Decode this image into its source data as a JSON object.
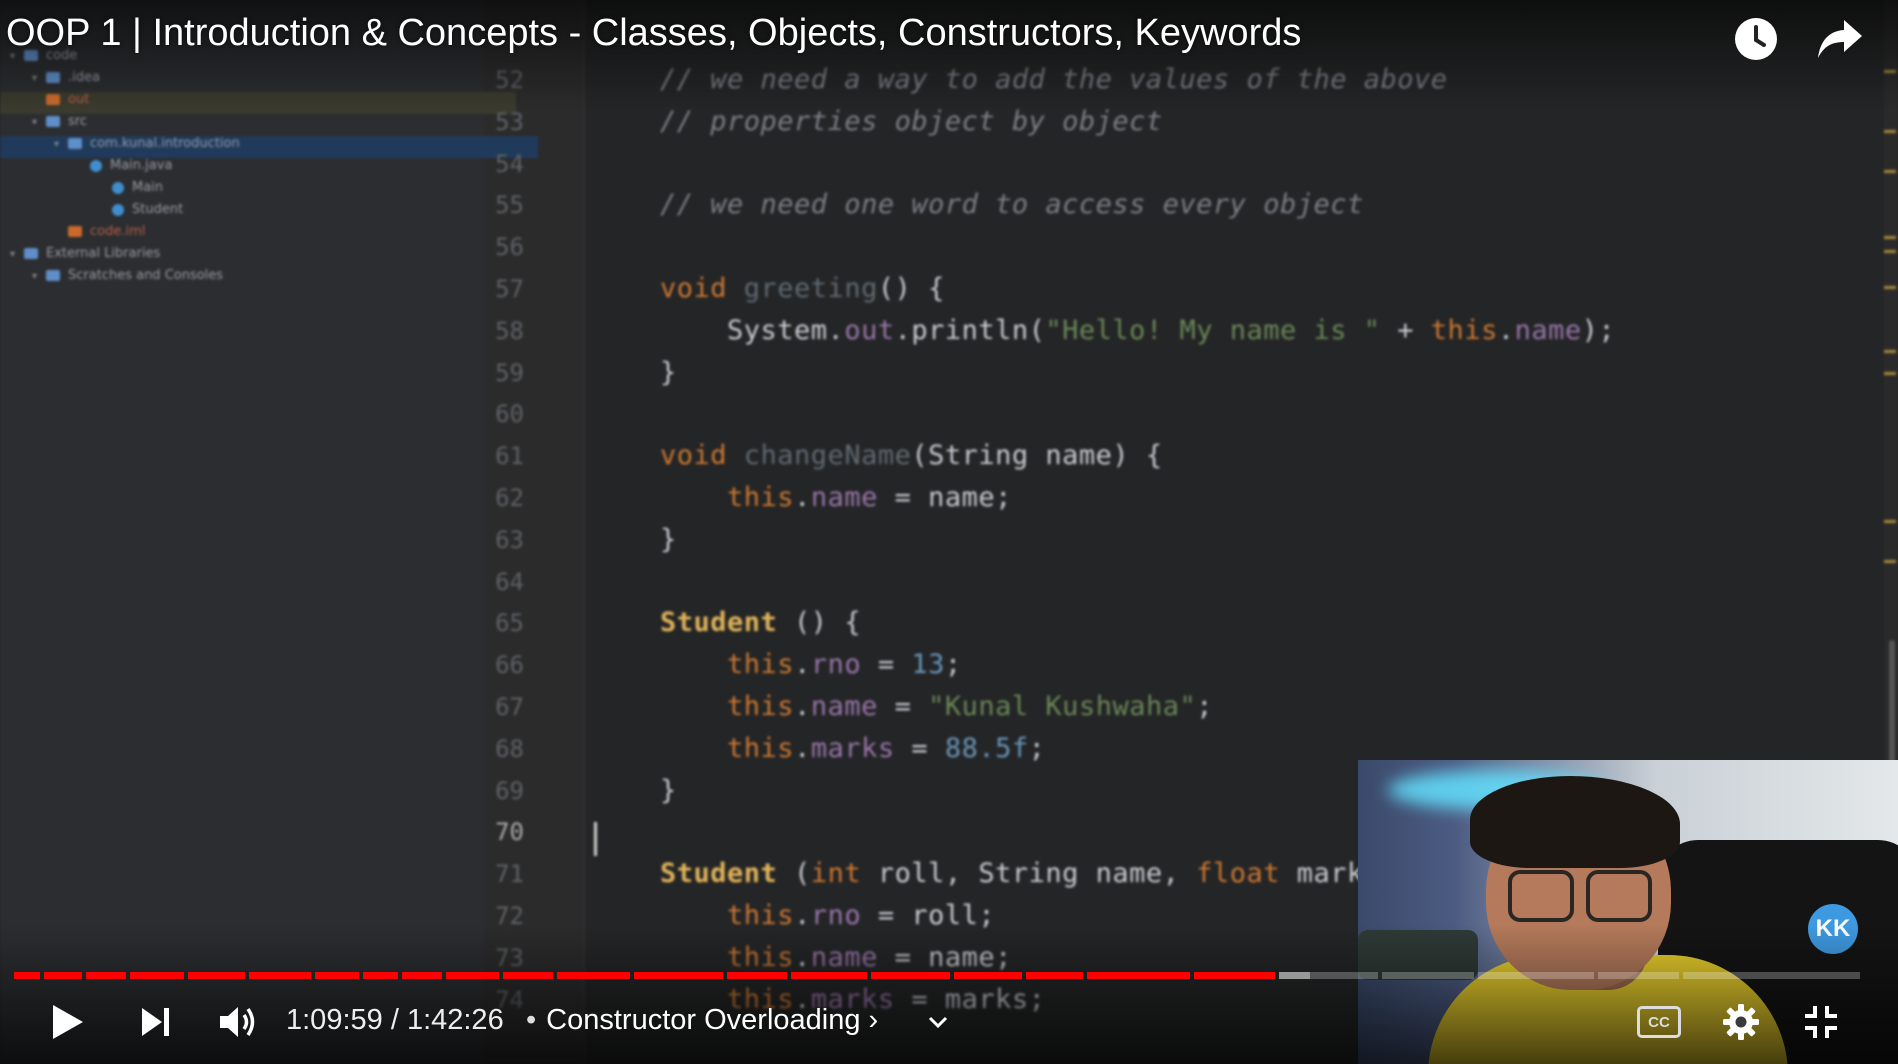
{
  "title": "OOP 1 | Introduction & Concepts - Classes, Objects, Constructors, Keywords",
  "top_controls": {
    "watch_later_icon": "clock-icon",
    "share_icon": "share-arrow-icon"
  },
  "ide": {
    "project_tree": [
      {
        "label": "code",
        "kind": "folder",
        "indent": 0
      },
      {
        "label": ".idea",
        "kind": "folder",
        "indent": 1
      },
      {
        "label": "out",
        "kind": "orange",
        "indent": 1
      },
      {
        "label": "src",
        "kind": "folder",
        "indent": 1
      },
      {
        "label": "com.kunal.introduction",
        "kind": "folder",
        "indent": 2
      },
      {
        "label": "Main.java",
        "kind": "java",
        "indent": 3
      },
      {
        "label": "Main",
        "kind": "java",
        "indent": 4
      },
      {
        "label": "Student",
        "kind": "java",
        "indent": 4
      },
      {
        "label": "code.iml",
        "kind": "orange",
        "indent": 2
      },
      {
        "label": "External Libraries",
        "kind": "ext",
        "indent": 0
      },
      {
        "label": "Scratches and Consoles",
        "kind": "ext",
        "indent": 1
      }
    ],
    "line_numbers": [
      "52",
      "53",
      "54",
      "55",
      "56",
      "57",
      "58",
      "59",
      "60",
      "61",
      "62",
      "63",
      "64",
      "65",
      "66",
      "67",
      "68",
      "69",
      "70",
      "71",
      "72",
      "73",
      "74"
    ],
    "current_line": "70",
    "code_lines": [
      {
        "ln": "52",
        "tokens": [
          {
            "c": "cm",
            "t": "// we need a way to add the values of the above"
          }
        ]
      },
      {
        "ln": "53",
        "tokens": [
          {
            "c": "cm",
            "t": "// properties object by object"
          }
        ]
      },
      {
        "ln": "54",
        "tokens": []
      },
      {
        "ln": "55",
        "tokens": [
          {
            "c": "cm",
            "t": "// we need one word to access every object"
          }
        ]
      },
      {
        "ln": "56",
        "tokens": []
      },
      {
        "ln": "57",
        "tokens": [
          {
            "c": "kw",
            "t": "void "
          },
          {
            "c": "fn",
            "t": "greeting"
          },
          {
            "c": "pl",
            "t": "() {"
          }
        ]
      },
      {
        "ln": "58",
        "tokens": [
          {
            "c": "pl",
            "t": "    System."
          },
          {
            "c": "fld",
            "t": "out"
          },
          {
            "c": "pl",
            "t": ".println("
          },
          {
            "c": "str",
            "t": "\"Hello! My name is \""
          },
          {
            "c": "pl",
            "t": " + "
          },
          {
            "c": "th",
            "t": "this"
          },
          {
            "c": "pl",
            "t": "."
          },
          {
            "c": "fld",
            "t": "name"
          },
          {
            "c": "pl",
            "t": ");"
          }
        ]
      },
      {
        "ln": "59",
        "tokens": [
          {
            "c": "pl",
            "t": "}"
          }
        ]
      },
      {
        "ln": "60",
        "tokens": []
      },
      {
        "ln": "61",
        "tokens": [
          {
            "c": "kw",
            "t": "void "
          },
          {
            "c": "fn",
            "t": "changeName"
          },
          {
            "c": "pl",
            "t": "(String name) {"
          }
        ]
      },
      {
        "ln": "62",
        "tokens": [
          {
            "c": "pl",
            "t": "    "
          },
          {
            "c": "th",
            "t": "this"
          },
          {
            "c": "pl",
            "t": "."
          },
          {
            "c": "fld",
            "t": "name"
          },
          {
            "c": "pl",
            "t": " = name;"
          }
        ]
      },
      {
        "ln": "63",
        "tokens": [
          {
            "c": "pl",
            "t": "}"
          }
        ]
      },
      {
        "ln": "64",
        "tokens": []
      },
      {
        "ln": "65",
        "tokens": [
          {
            "c": "ty",
            "t": "Student"
          },
          {
            "c": "pl",
            "t": " () {"
          }
        ]
      },
      {
        "ln": "66",
        "tokens": [
          {
            "c": "pl",
            "t": "    "
          },
          {
            "c": "th",
            "t": "this"
          },
          {
            "c": "pl",
            "t": "."
          },
          {
            "c": "fld",
            "t": "rno"
          },
          {
            "c": "pl",
            "t": " = "
          },
          {
            "c": "num",
            "t": "13"
          },
          {
            "c": "pl",
            "t": ";"
          }
        ]
      },
      {
        "ln": "67",
        "tokens": [
          {
            "c": "pl",
            "t": "    "
          },
          {
            "c": "th",
            "t": "this"
          },
          {
            "c": "pl",
            "t": "."
          },
          {
            "c": "fld",
            "t": "name"
          },
          {
            "c": "pl",
            "t": " = "
          },
          {
            "c": "str",
            "t": "\"Kunal Kushwaha\""
          },
          {
            "c": "pl",
            "t": ";"
          }
        ]
      },
      {
        "ln": "68",
        "tokens": [
          {
            "c": "pl",
            "t": "    "
          },
          {
            "c": "th",
            "t": "this"
          },
          {
            "c": "pl",
            "t": "."
          },
          {
            "c": "fld",
            "t": "marks"
          },
          {
            "c": "pl",
            "t": " = "
          },
          {
            "c": "num",
            "t": "88.5f"
          },
          {
            "c": "pl",
            "t": ";"
          }
        ]
      },
      {
        "ln": "69",
        "tokens": [
          {
            "c": "pl",
            "t": "}"
          }
        ]
      },
      {
        "ln": "70",
        "tokens": []
      },
      {
        "ln": "71",
        "tokens": [
          {
            "c": "ty",
            "t": "Student"
          },
          {
            "c": "pl",
            "t": " ("
          },
          {
            "c": "kw",
            "t": "int "
          },
          {
            "c": "pl",
            "t": "roll, String name, "
          },
          {
            "c": "kw",
            "t": "float "
          },
          {
            "c": "pl",
            "t": "marks"
          }
        ]
      },
      {
        "ln": "72",
        "tokens": [
          {
            "c": "pl",
            "t": "    "
          },
          {
            "c": "th",
            "t": "this"
          },
          {
            "c": "pl",
            "t": "."
          },
          {
            "c": "fld",
            "t": "rno"
          },
          {
            "c": "pl",
            "t": " = roll;"
          }
        ]
      },
      {
        "ln": "73",
        "tokens": [
          {
            "c": "pl",
            "t": "    "
          },
          {
            "c": "th",
            "t": "this"
          },
          {
            "c": "pl",
            "t": "."
          },
          {
            "c": "fld",
            "t": "name"
          },
          {
            "c": "pl",
            "t": " = name;"
          }
        ]
      },
      {
        "ln": "74",
        "tokens": [
          {
            "c": "pl",
            "t": "    "
          },
          {
            "c": "th",
            "t": "this"
          },
          {
            "c": "pl",
            "t": "."
          },
          {
            "c": "fld",
            "t": "marks"
          },
          {
            "c": "pl",
            "t": " = marks;"
          }
        ]
      }
    ]
  },
  "channel_badge": "KK",
  "progress": {
    "played_fraction": 0.684,
    "buffered_fraction": 0.702,
    "chapter_fractions": [
      0.015,
      0.038,
      0.062,
      0.093,
      0.126,
      0.162,
      0.188,
      0.209,
      0.233,
      0.264,
      0.293,
      0.335,
      0.385,
      0.42,
      0.463,
      0.508,
      0.547,
      0.58,
      0.638,
      0.684,
      0.74,
      0.792,
      0.857,
      0.903
    ]
  },
  "controls": {
    "play_icon": "play-icon",
    "next_icon": "next-icon",
    "volume_icon": "volume-icon",
    "current_time": "1:09:59",
    "time_separator": " / ",
    "duration": "1:42:26",
    "chapter_separator": "•",
    "chapter_title": "Constructor Overloading",
    "chapter_chevron": "›",
    "expand_icon": "chevron-down-icon",
    "cc_label": "CC",
    "settings_icon": "gear-icon",
    "exit_fullscreen_icon": "exit-fullscreen-icon"
  },
  "colors": {
    "progress_played": "#ff0000",
    "accent_badge": "#3e9ae0"
  }
}
